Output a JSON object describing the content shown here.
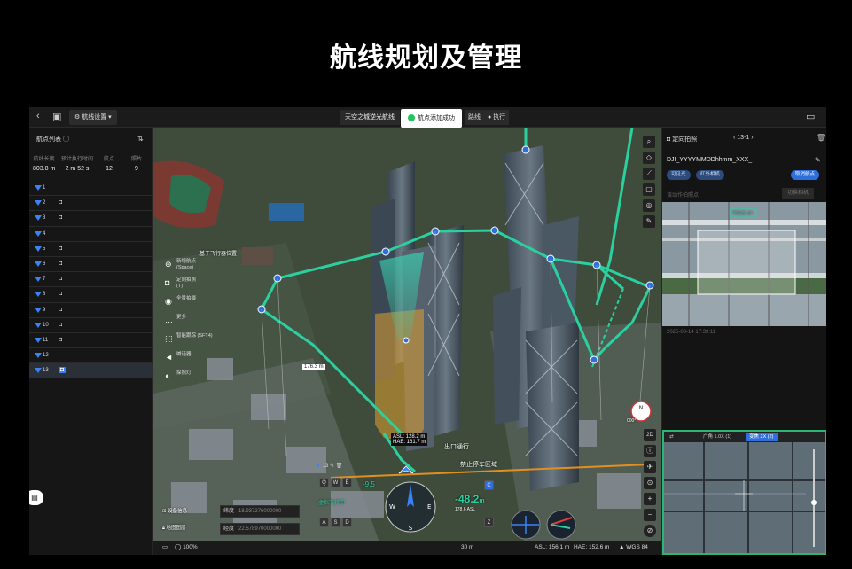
{
  "page_title": "航线规划及管理",
  "topbar": {
    "route_settings": "航线设置",
    "center_title": "天空之城逆光航线",
    "toast": "航点添加成功",
    "sim_btn": "路线",
    "exec_btn": "执行"
  },
  "left_panel": {
    "title": "航点列表",
    "stats": [
      {
        "label": "航线长度",
        "value": "803.8 m"
      },
      {
        "label": "预计执行时间",
        "value": "2 m 52 s"
      },
      {
        "label": "航点",
        "value": "12"
      },
      {
        "label": "照片",
        "value": "9"
      }
    ],
    "waypoints": [
      {
        "num": "1",
        "cam": ""
      },
      {
        "num": "2",
        "cam": "◘"
      },
      {
        "num": "3",
        "cam": "◘"
      },
      {
        "num": "4",
        "cam": ""
      },
      {
        "num": "5",
        "cam": "◘"
      },
      {
        "num": "6",
        "cam": "◘"
      },
      {
        "num": "7",
        "cam": "◘"
      },
      {
        "num": "8",
        "cam": "◘"
      },
      {
        "num": "9",
        "cam": "◘"
      },
      {
        "num": "10",
        "cam": "◘"
      },
      {
        "num": "11",
        "cam": "◘"
      },
      {
        "num": "12",
        "cam": ""
      },
      {
        "num": "13",
        "cam": "◘"
      }
    ]
  },
  "map": {
    "ctx_title": "基于飞行器位置",
    "ctx_items": [
      {
        "label": "新增航点",
        "sub": "(Space)"
      },
      {
        "label": "定向拍照",
        "sub": "(T)"
      },
      {
        "label": "全景拍摄",
        "sub": ""
      },
      {
        "label": "更多",
        "sub": ""
      },
      {
        "label": "智能跟踪 (SFT4)",
        "sub": ""
      },
      {
        "label": "喊话器",
        "sub": ""
      },
      {
        "label": "探照灯",
        "sub": ""
      }
    ],
    "distance_label": "176.3 m",
    "asl_label": "ASL: 128.2 m",
    "hae_label": "HAE: 161.7 m",
    "label_exit": "出口通行",
    "label_ban": "禁止停车区域",
    "wp_indicator": "13",
    "speed_val": "-9.5",
    "alt_val": "-48.2",
    "alt_unit": "m",
    "alt_asl": "178.6 ASL",
    "heading": "000°",
    "wind_label": "虚拟飞行中",
    "lat_label": "纬度",
    "lat_val": "18.937276000000",
    "lng_label": "经度",
    "lng_val": "22.578970000000",
    "left_btns": [
      "设备信息",
      "地图图层"
    ],
    "zoom_mode": "2D",
    "bottom": {
      "zoom": "100%",
      "dist": "30 m",
      "asl": "ASL: 156.1 m",
      "hae": "HAE: 152.6 m",
      "datum": "WGS 84"
    }
  },
  "right_panel": {
    "title": "定向拍照",
    "nav": "13-1",
    "filename": "DJI_YYYYMMDDhhmm_XXX_",
    "tags": [
      "可见光",
      "红外相机"
    ],
    "primary_tag": "取消航点",
    "sub": "该动作拍照点",
    "sub_btn": "切换相机",
    "photo_label": "可见光 1X",
    "time": "2025-03-14 17:39:11",
    "live_tabs": [
      "广角 1.0X (1)",
      "变焦 2X (2)"
    ]
  },
  "colors": {
    "accent": "#2f6fdc",
    "route": "#2bd0a0",
    "wp_blue": "#3b82f6",
    "ok": "#22c55e"
  }
}
